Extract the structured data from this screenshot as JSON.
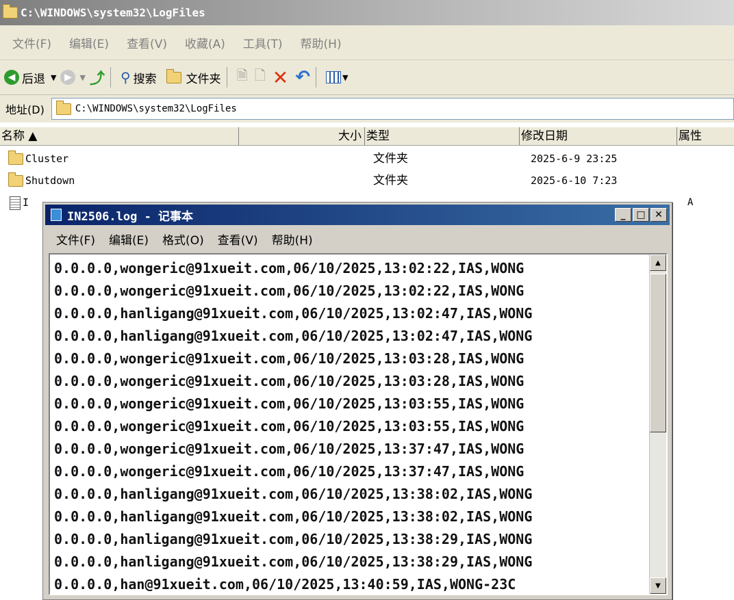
{
  "window_title": "C:\\WINDOWS\\system32\\LogFiles",
  "menu": [
    "文件(F)",
    "编辑(E)",
    "查看(V)",
    "收藏(A)",
    "工具(T)",
    "帮助(H)"
  ],
  "toolbar": {
    "back": "后退",
    "search": "搜索",
    "folders": "文件夹"
  },
  "address": {
    "label": "地址(D)",
    "value": "C:\\WINDOWS\\system32\\LogFiles"
  },
  "columns": {
    "name": "名称 ▲",
    "size": "大小",
    "type": "类型",
    "modified": "修改日期",
    "attributes": "属性"
  },
  "files": [
    {
      "name": "Cluster",
      "type": "文件夹",
      "modified": "2025-6-9 23:25",
      "attr": ""
    },
    {
      "name": "Shutdown",
      "type": "文件夹",
      "modified": "2025-6-10 7:23",
      "attr": ""
    },
    {
      "name": "I",
      "type": "",
      "modified": "",
      "attr": "A"
    }
  ],
  "notepad": {
    "title": "IN2506.log - 记事本",
    "menu": [
      "文件(F)",
      "编辑(E)",
      "格式(O)",
      "查看(V)",
      "帮助(H)"
    ],
    "lines": [
      "0.0.0.0,wongeric@91xueit.com,06/10/2025,13:02:22,IAS,WONG",
      "0.0.0.0,wongeric@91xueit.com,06/10/2025,13:02:22,IAS,WONG",
      "0.0.0.0,hanligang@91xueit.com,06/10/2025,13:02:47,IAS,WONG",
      "0.0.0.0,hanligang@91xueit.com,06/10/2025,13:02:47,IAS,WONG",
      "0.0.0.0,wongeric@91xueit.com,06/10/2025,13:03:28,IAS,WONG",
      "0.0.0.0,wongeric@91xueit.com,06/10/2025,13:03:28,IAS,WONG",
      "0.0.0.0,wongeric@91xueit.com,06/10/2025,13:03:55,IAS,WONG",
      "0.0.0.0,wongeric@91xueit.com,06/10/2025,13:03:55,IAS,WONG",
      "0.0.0.0,wongeric@91xueit.com,06/10/2025,13:37:47,IAS,WONG",
      "0.0.0.0,wongeric@91xueit.com,06/10/2025,13:37:47,IAS,WONG",
      "0.0.0.0,hanligang@91xueit.com,06/10/2025,13:38:02,IAS,WONG",
      "0.0.0.0,hanligang@91xueit.com,06/10/2025,13:38:02,IAS,WONG",
      "0.0.0.0,hanligang@91xueit.com,06/10/2025,13:38:29,IAS,WONG",
      "0.0.0.0,hanligang@91xueit.com,06/10/2025,13:38:29,IAS,WONG",
      "0.0.0.0,han@91xueit.com,06/10/2025,13:40:59,IAS,WONG-23C"
    ]
  }
}
